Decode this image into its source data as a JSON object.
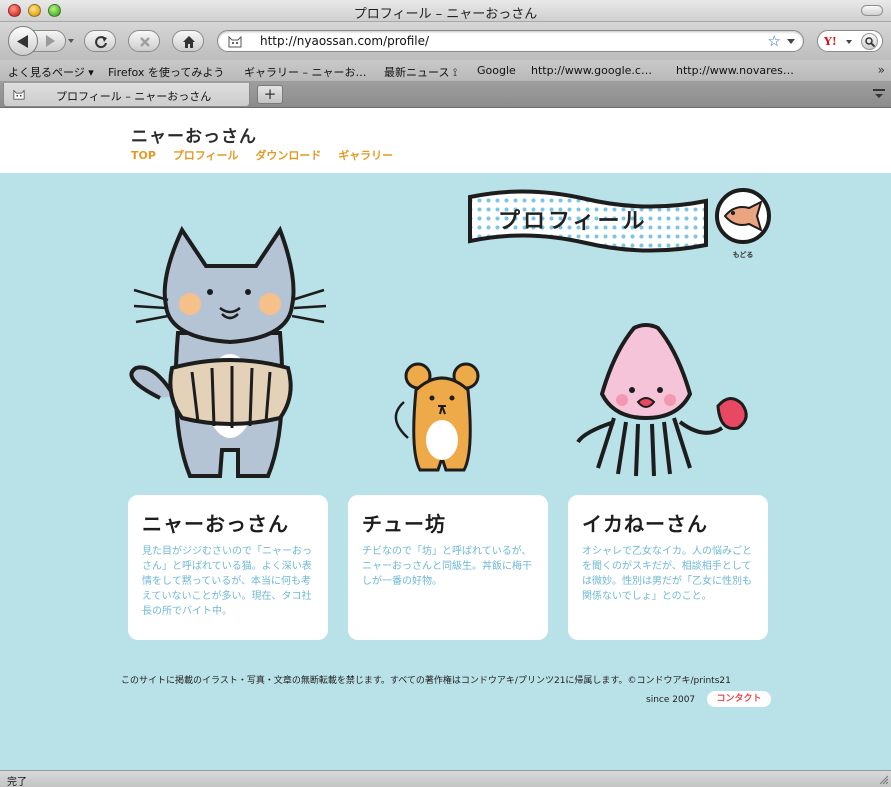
{
  "window": {
    "title": "プロフィール – ニャーおっさん"
  },
  "toolbar": {
    "url": "http://nyaossan.com/profile/",
    "search_engine_icon": "Y!"
  },
  "bookmarks": [
    "よく見るページ ▾",
    "Firefox を使ってみよう",
    "ギャラリー – ニャーお…",
    "最新ニュース ⟟",
    "Google",
    "http://www.google.c…",
    "http://www.novares…"
  ],
  "bookmarks_more": "»",
  "tabs": [
    {
      "label": "プロフィール – ニャーおっさん"
    }
  ],
  "newtab_label": "+",
  "site": {
    "logo": "ニャーおっさん",
    "nav": [
      "TOP",
      "プロフィール",
      "ダウンロード",
      "ギャラリー"
    ],
    "banner_title": "プロフィール",
    "back_label": "もどる"
  },
  "characters": [
    {
      "name": "ニャーおっさん",
      "desc": "見た目がジジむさいので「ニャーおっさん」と呼ばれている猫。よく深い表情をして黙っているが、本当に何も考えていないことが多い。現在、タコ社長の所でバイト中。"
    },
    {
      "name": "チュー坊",
      "desc": "チビなので「坊」と呼ばれているが、ニャーおっさんと同級生。丼飯に梅干しが一番の好物。"
    },
    {
      "name": "イカねーさん",
      "desc": "オシャレで乙女なイカ。人の悩みごとを聞くのがスキだが、相談相手としては微妙。性別は男だが「乙女に性別も関係ないでしょ」とのこと。"
    }
  ],
  "footer": {
    "copyright": "このサイトに掲載のイラスト・写真・文章の無断転載を禁じます。すべての著作権はコンドウアキ/プリンツ21に帰属します。©コンドウアキ/prints21",
    "since": "since 2007",
    "contact": "コンタクト"
  },
  "status": {
    "text": "完了"
  },
  "colors": {
    "page_background": "#b9e1e8",
    "nav_link": "#e39a25",
    "card_text": "#6fb8d6",
    "contact_text": "#e8464f"
  }
}
